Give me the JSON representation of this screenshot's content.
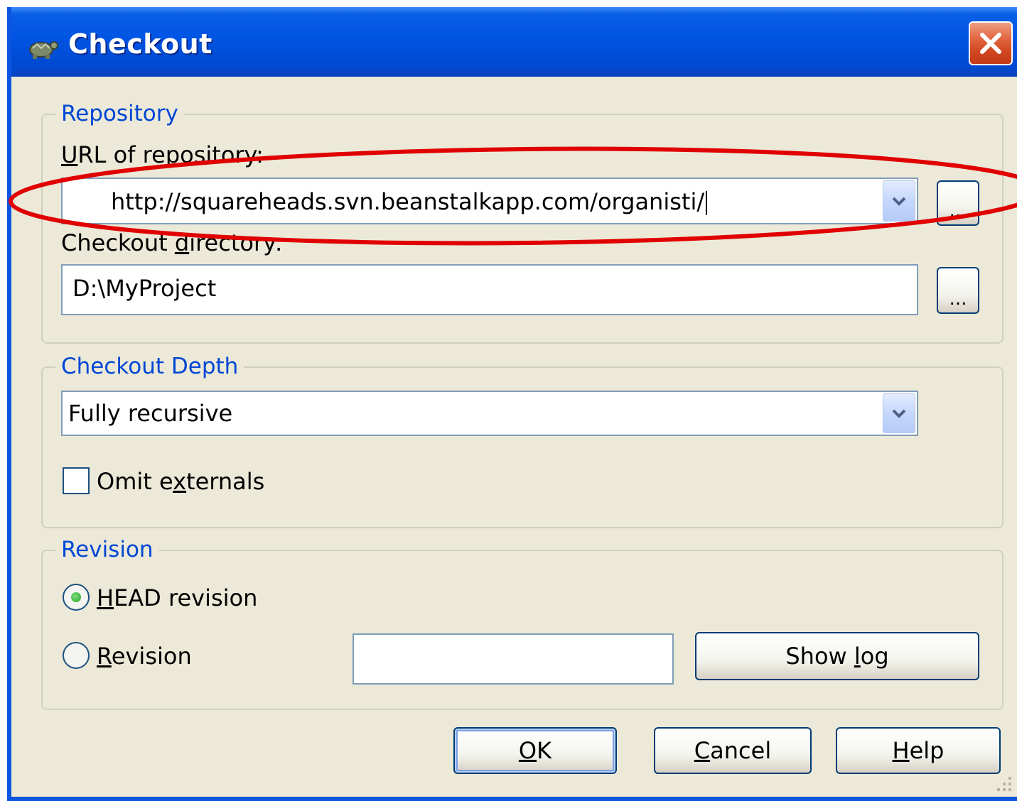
{
  "window": {
    "title": "Checkout",
    "close_glyph": "✕"
  },
  "repository": {
    "legend": "Repository",
    "url_label_ul": "U",
    "url_label_rest": "RL of repository:",
    "url_value": "http://squareheads.svn.beanstalkapp.com/organisti/",
    "url_browse": "...",
    "dir_label_pre": "Checkout ",
    "dir_label_ul": "d",
    "dir_label_post": "irectory:",
    "dir_value": "D:\\MyProject",
    "dir_browse": "..."
  },
  "depth": {
    "legend": "Checkout Depth",
    "selected": "Fully recursive",
    "omit_pre": "Omit e",
    "omit_ul": "x",
    "omit_post": "ternals",
    "omit_checked": false
  },
  "revision": {
    "legend": "Revision",
    "head_ul": "H",
    "head_rest": "EAD revision",
    "head_checked": true,
    "rev_ul": "R",
    "rev_rest": "evision",
    "rev_checked": false,
    "rev_value": "",
    "show_log_pre": "Show ",
    "show_log_ul": "l",
    "show_log_post": "og"
  },
  "buttons": {
    "ok_ul": "O",
    "ok_rest": "K",
    "cancel_ul": "C",
    "cancel_rest": "ancel",
    "help_ul": "H",
    "help_rest": "elp"
  },
  "colors": {
    "titlebar": "#0054e3",
    "dialog_bg": "#ece9d8",
    "legend_text": "#0046d5",
    "annotation": "#e00000"
  },
  "icons": {
    "app": "tortoise-icon",
    "close": "close-icon",
    "dropdown": "chevron-down-icon",
    "grip": "resize-grip-icon"
  }
}
